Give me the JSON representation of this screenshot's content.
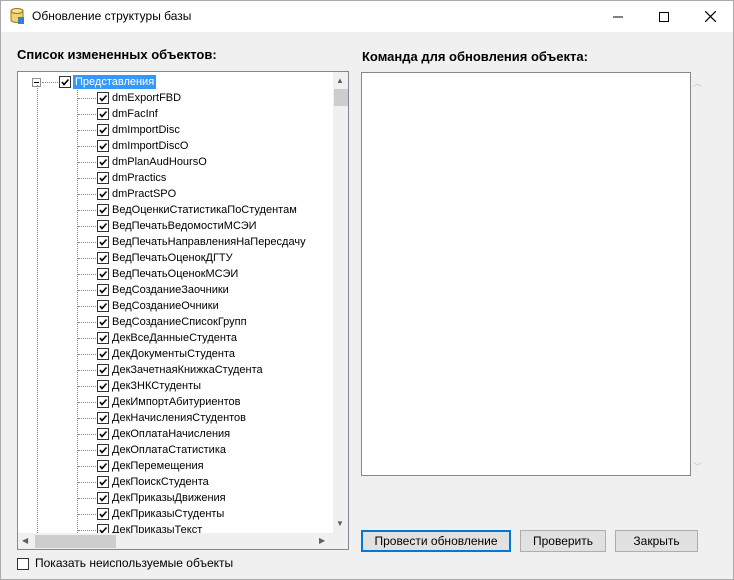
{
  "window": {
    "title": "Обновление структуры базы",
    "icon": "database-icon"
  },
  "left_panel": {
    "label": "Список измененных объектов:",
    "tree": {
      "root": {
        "label": "Представления",
        "checked": true,
        "expanded": true,
        "selected": true
      },
      "items": [
        {
          "label": "dmExportFBD",
          "checked": true
        },
        {
          "label": "dmFacInf",
          "checked": true
        },
        {
          "label": "dmImportDisc",
          "checked": true
        },
        {
          "label": "dmImportDiscO",
          "checked": true
        },
        {
          "label": "dmPlanAudHoursO",
          "checked": true
        },
        {
          "label": "dmPractics",
          "checked": true
        },
        {
          "label": "dmPractSPO",
          "checked": true
        },
        {
          "label": "ВедОценкиСтатистикаПоСтудентам",
          "checked": true
        },
        {
          "label": "ВедПечатьВедомостиМСЭИ",
          "checked": true
        },
        {
          "label": "ВедПечатьНаправленияНаПересдачу",
          "checked": true
        },
        {
          "label": "ВедПечатьОценокДГТУ",
          "checked": true
        },
        {
          "label": "ВедПечатьОценокМСЭИ",
          "checked": true
        },
        {
          "label": "ВедСозданиеЗаочники",
          "checked": true
        },
        {
          "label": "ВедСозданиеОчники",
          "checked": true
        },
        {
          "label": "ВедСозданиеСписокГрупп",
          "checked": true
        },
        {
          "label": "ДекВсеДанныеСтудента",
          "checked": true
        },
        {
          "label": "ДекДокументыСтудента",
          "checked": true
        },
        {
          "label": "ДекЗачетнаяКнижкаСтудента",
          "checked": true
        },
        {
          "label": "ДекЗНКСтуденты",
          "checked": true
        },
        {
          "label": "ДекИмпортАбитуриентов",
          "checked": true
        },
        {
          "label": "ДекНачисленияСтудентов",
          "checked": true
        },
        {
          "label": "ДекОплатаНачисления",
          "checked": true
        },
        {
          "label": "ДекОплатаСтатистика",
          "checked": true
        },
        {
          "label": "ДекПеремещения",
          "checked": true
        },
        {
          "label": "ДекПоискСтудента",
          "checked": true
        },
        {
          "label": "ДекПриказыДвижения",
          "checked": true
        },
        {
          "label": "ДекПриказыСтуденты",
          "checked": true
        },
        {
          "label": "ДекПриказыТекст",
          "checked": true
        }
      ]
    }
  },
  "right_panel": {
    "label": "Команда для обновления объекта:",
    "command_text": ""
  },
  "buttons": {
    "apply": "Провести обновление",
    "check": "Проверить",
    "close": "Закрыть"
  },
  "show_unused": {
    "label": "Показать неиспользуемые объекты",
    "checked": false
  }
}
